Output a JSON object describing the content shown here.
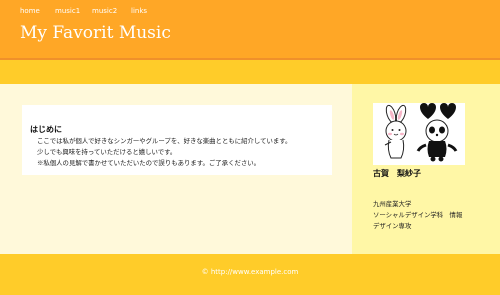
{
  "header": {
    "title": "My Favorit Music"
  },
  "nav": {
    "items": [
      "home",
      "music1",
      "music2",
      "links"
    ]
  },
  "intro": {
    "heading": "はじめに",
    "lines": [
      "ここでは私が個人で好きなシンガーやグループを、好きな楽曲とともに紹介しています。",
      "少しでも興味を持っていただけると嬉しいです。",
      "※私個人の見解で書かせていただいたので誤りもあります。ご了承ください。"
    ]
  },
  "sidebar": {
    "name": "古賀　梨紗子",
    "affiliation": [
      "九州産業大学",
      "ソーシャルデザイン学科　情報",
      "デザイン専攻"
    ]
  },
  "footer": {
    "copyright": "© http://www.example.com"
  }
}
